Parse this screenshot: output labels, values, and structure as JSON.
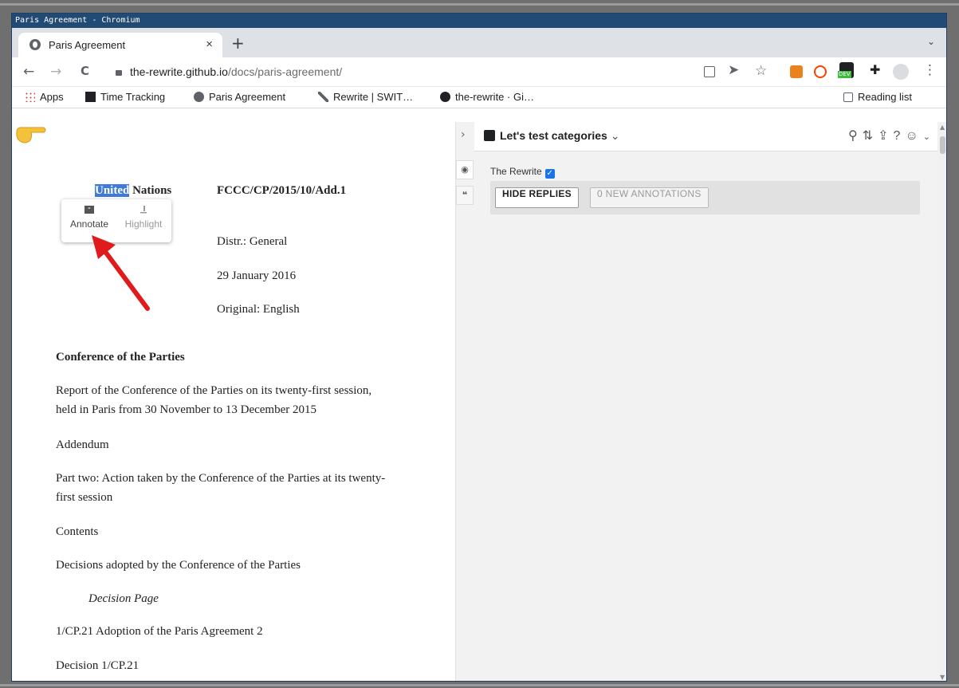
{
  "window": {
    "title": "Paris Agreement - Chromium"
  },
  "tab": {
    "title": "Paris Agreement",
    "close": "×",
    "new": "+",
    "menu": "⌄"
  },
  "toolbar": {
    "back": "←",
    "forward": "→",
    "reload": "C",
    "url_host": "the-rewrite.github.io",
    "url_path": "/docs/paris-agreement/",
    "icons": [
      "reader-mode-icon",
      "send-icon",
      "bookmark-star-icon",
      "metamask-icon",
      "svelte-icon",
      "dev-extension-icon",
      "extensions-icon",
      "profile-icon",
      "menu-icon"
    ],
    "dev_badge": "DEV",
    "star": "☆",
    "kebab": "⋮"
  },
  "bookmarks": {
    "items": [
      "Apps",
      "Time Tracking",
      "Paris Agreement",
      "Rewrite | SWIT…",
      "the-rewrite · Gi…"
    ],
    "reading_list": "Reading list"
  },
  "document": {
    "org_highlight": "United",
    "org_rest": " Nations",
    "symbol": "FCCC/CP/2015/10/Add.1",
    "distr": "Distr.: General",
    "date": "29 January 2016",
    "original": "Original: English",
    "heading": "Conference of the Parties",
    "report_line1": "Report of the Conference of the Parties on its twenty-first session,",
    "report_line2": "held in Paris from 30 November to 13 December 2015",
    "addendum": "Addendum",
    "part_line1": "Part two: Action taken by the Conference of the Parties at its twenty-",
    "part_line2": "first session",
    "contents": "Contents",
    "decisions": "Decisions adopted by the Conference of the Parties",
    "decision_page": "Decision Page",
    "item1": "1/CP.21 Adoption of the Paris Agreement 2",
    "decision": "Decision 1/CP.21"
  },
  "popup": {
    "annotate": "Annotate",
    "highlight": "Highlight"
  },
  "sidebar": {
    "collapse": "›",
    "group_title": "Let's test categories",
    "group_chevron": "⌄",
    "icons": [
      "search-icon",
      "sort-icon",
      "share-icon",
      "help-icon",
      "user-icon",
      "chevron-down-icon"
    ],
    "filter_label": "The Rewrite",
    "hide_replies": "HIDE REPLIES",
    "new_annotations": "0 NEW ANNOTATIONS"
  },
  "colors": {
    "titlebar": "#214a75",
    "selection": "#3f7ad9",
    "arrow": "#e01b1b",
    "check": "#1a73e8"
  }
}
